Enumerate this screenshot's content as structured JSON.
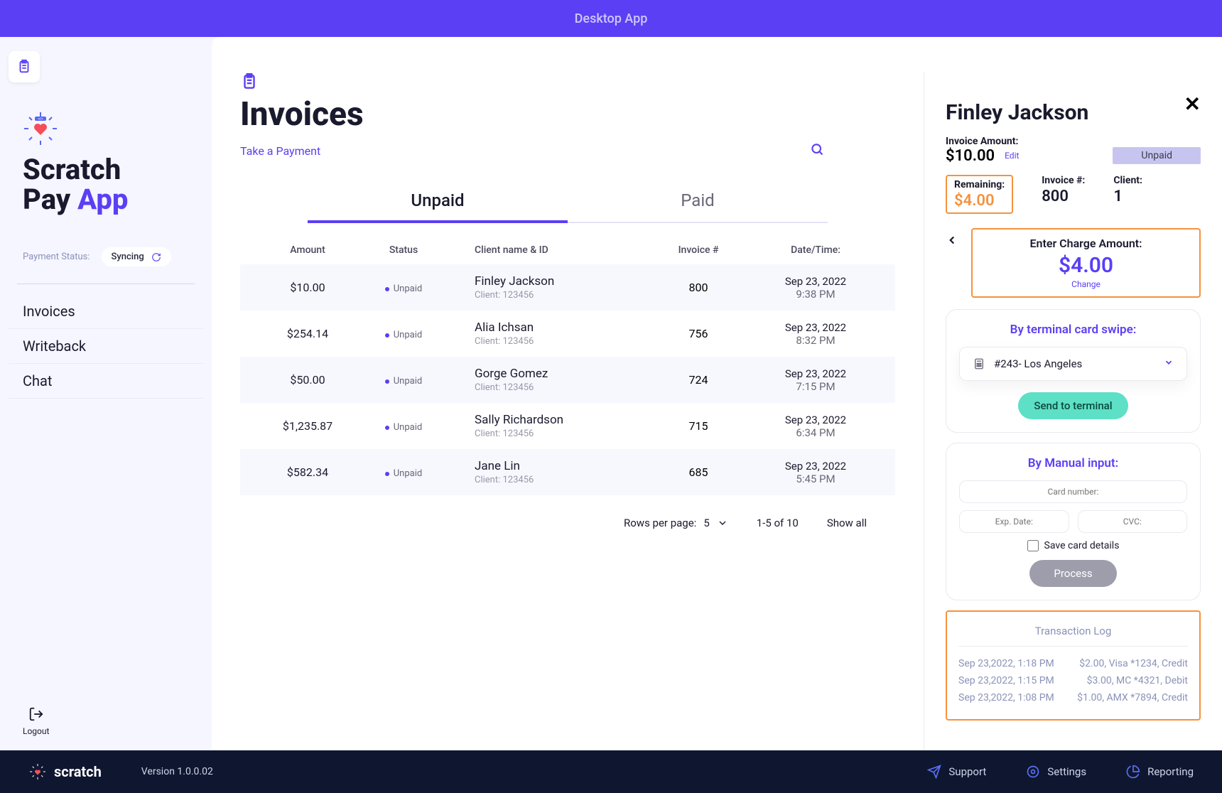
{
  "topbar": {
    "title": "Desktop App"
  },
  "sidebar": {
    "brand_line1": "Scratch",
    "brand_line2a": "Pay ",
    "brand_line2b": "App",
    "payment_status_label": "Payment Status:",
    "sync_label": "Syncing",
    "nav": {
      "invoices": "Invoices",
      "writeback": "Writeback",
      "chat": "Chat"
    },
    "logout": "Logout"
  },
  "main": {
    "title": "Invoices",
    "take_payment": "Take a Payment",
    "tabs": {
      "unpaid": "Unpaid",
      "paid": "Paid"
    },
    "columns": {
      "amount": "Amount",
      "status": "Status",
      "client": "Client name & ID",
      "invoice": "Invoice #",
      "date": "Date/Time:"
    },
    "rows": [
      {
        "amount": "$10.00",
        "status": "Unpaid",
        "name": "Finley Jackson",
        "client": "Client: 123456",
        "inv": "800",
        "date1": "Sep 23, 2022",
        "date2": "9:38 PM"
      },
      {
        "amount": "$254.14",
        "status": "Unpaid",
        "name": "Alia Ichsan",
        "client": "Client: 123456",
        "inv": "756",
        "date1": "Sep 23, 2022",
        "date2": "8:32 PM"
      },
      {
        "amount": "$50.00",
        "status": "Unpaid",
        "name": "Gorge Gomez",
        "client": "Client: 123456",
        "inv": "724",
        "date1": "Sep 23, 2022",
        "date2": "7:15 PM"
      },
      {
        "amount": "$1,235.87",
        "status": "Unpaid",
        "name": "Sally Richardson",
        "client": "Client: 123456",
        "inv": "715",
        "date1": "Sep 23, 2022",
        "date2": "6:34 PM"
      },
      {
        "amount": "$582.34",
        "status": "Unpaid",
        "name": "Jane Lin",
        "client": "Client: 123456",
        "inv": "685",
        "date1": "Sep 23, 2022",
        "date2": "5:45 PM"
      }
    ],
    "pager": {
      "rpp_label": "Rows per page:",
      "rpp_value": "5",
      "range": "1-5 of 10",
      "show_all": "Show all"
    }
  },
  "panel": {
    "client_name": "Finley Jackson",
    "inv_amt_label": "Invoice Amount:",
    "inv_amt_value": "$10.00",
    "edit": "Edit",
    "unpaid": "Unpaid",
    "remaining_label": "Remaining:",
    "remaining_value": "$4.00",
    "invnum_label": "Invoice #:",
    "invnum_value": "800",
    "client_label": "Client:",
    "client_value": "1",
    "charge_label": "Enter Charge Amount:",
    "charge_value": "$4.00",
    "change": "Change",
    "terminal_title": "By terminal card swipe:",
    "terminal_selected": "#243- Los Angeles",
    "send_btn": "Send to terminal",
    "manual_title": "By Manual input:",
    "card_number_ph": "Card number:",
    "exp_ph": "Exp. Date:",
    "cvc_ph": "CVC:",
    "save_card": "Save card details",
    "process": "Process",
    "txlog_title": "Transaction Log",
    "tx": [
      {
        "ts": "Sep 23,2022, 1:18 PM",
        "detail": "$2.00, Visa *1234, Credit"
      },
      {
        "ts": "Sep 23,2022, 1:15 PM",
        "detail": "$3.00, MC *4321, Debit"
      },
      {
        "ts": "Sep 23,2022, 1:08 PM",
        "detail": "$1.00, AMX *7894, Credit"
      }
    ]
  },
  "footer": {
    "brand": "scratch",
    "version": "Version 1.0.0.02",
    "support": "Support",
    "settings": "Settings",
    "reporting": "Reporting"
  }
}
